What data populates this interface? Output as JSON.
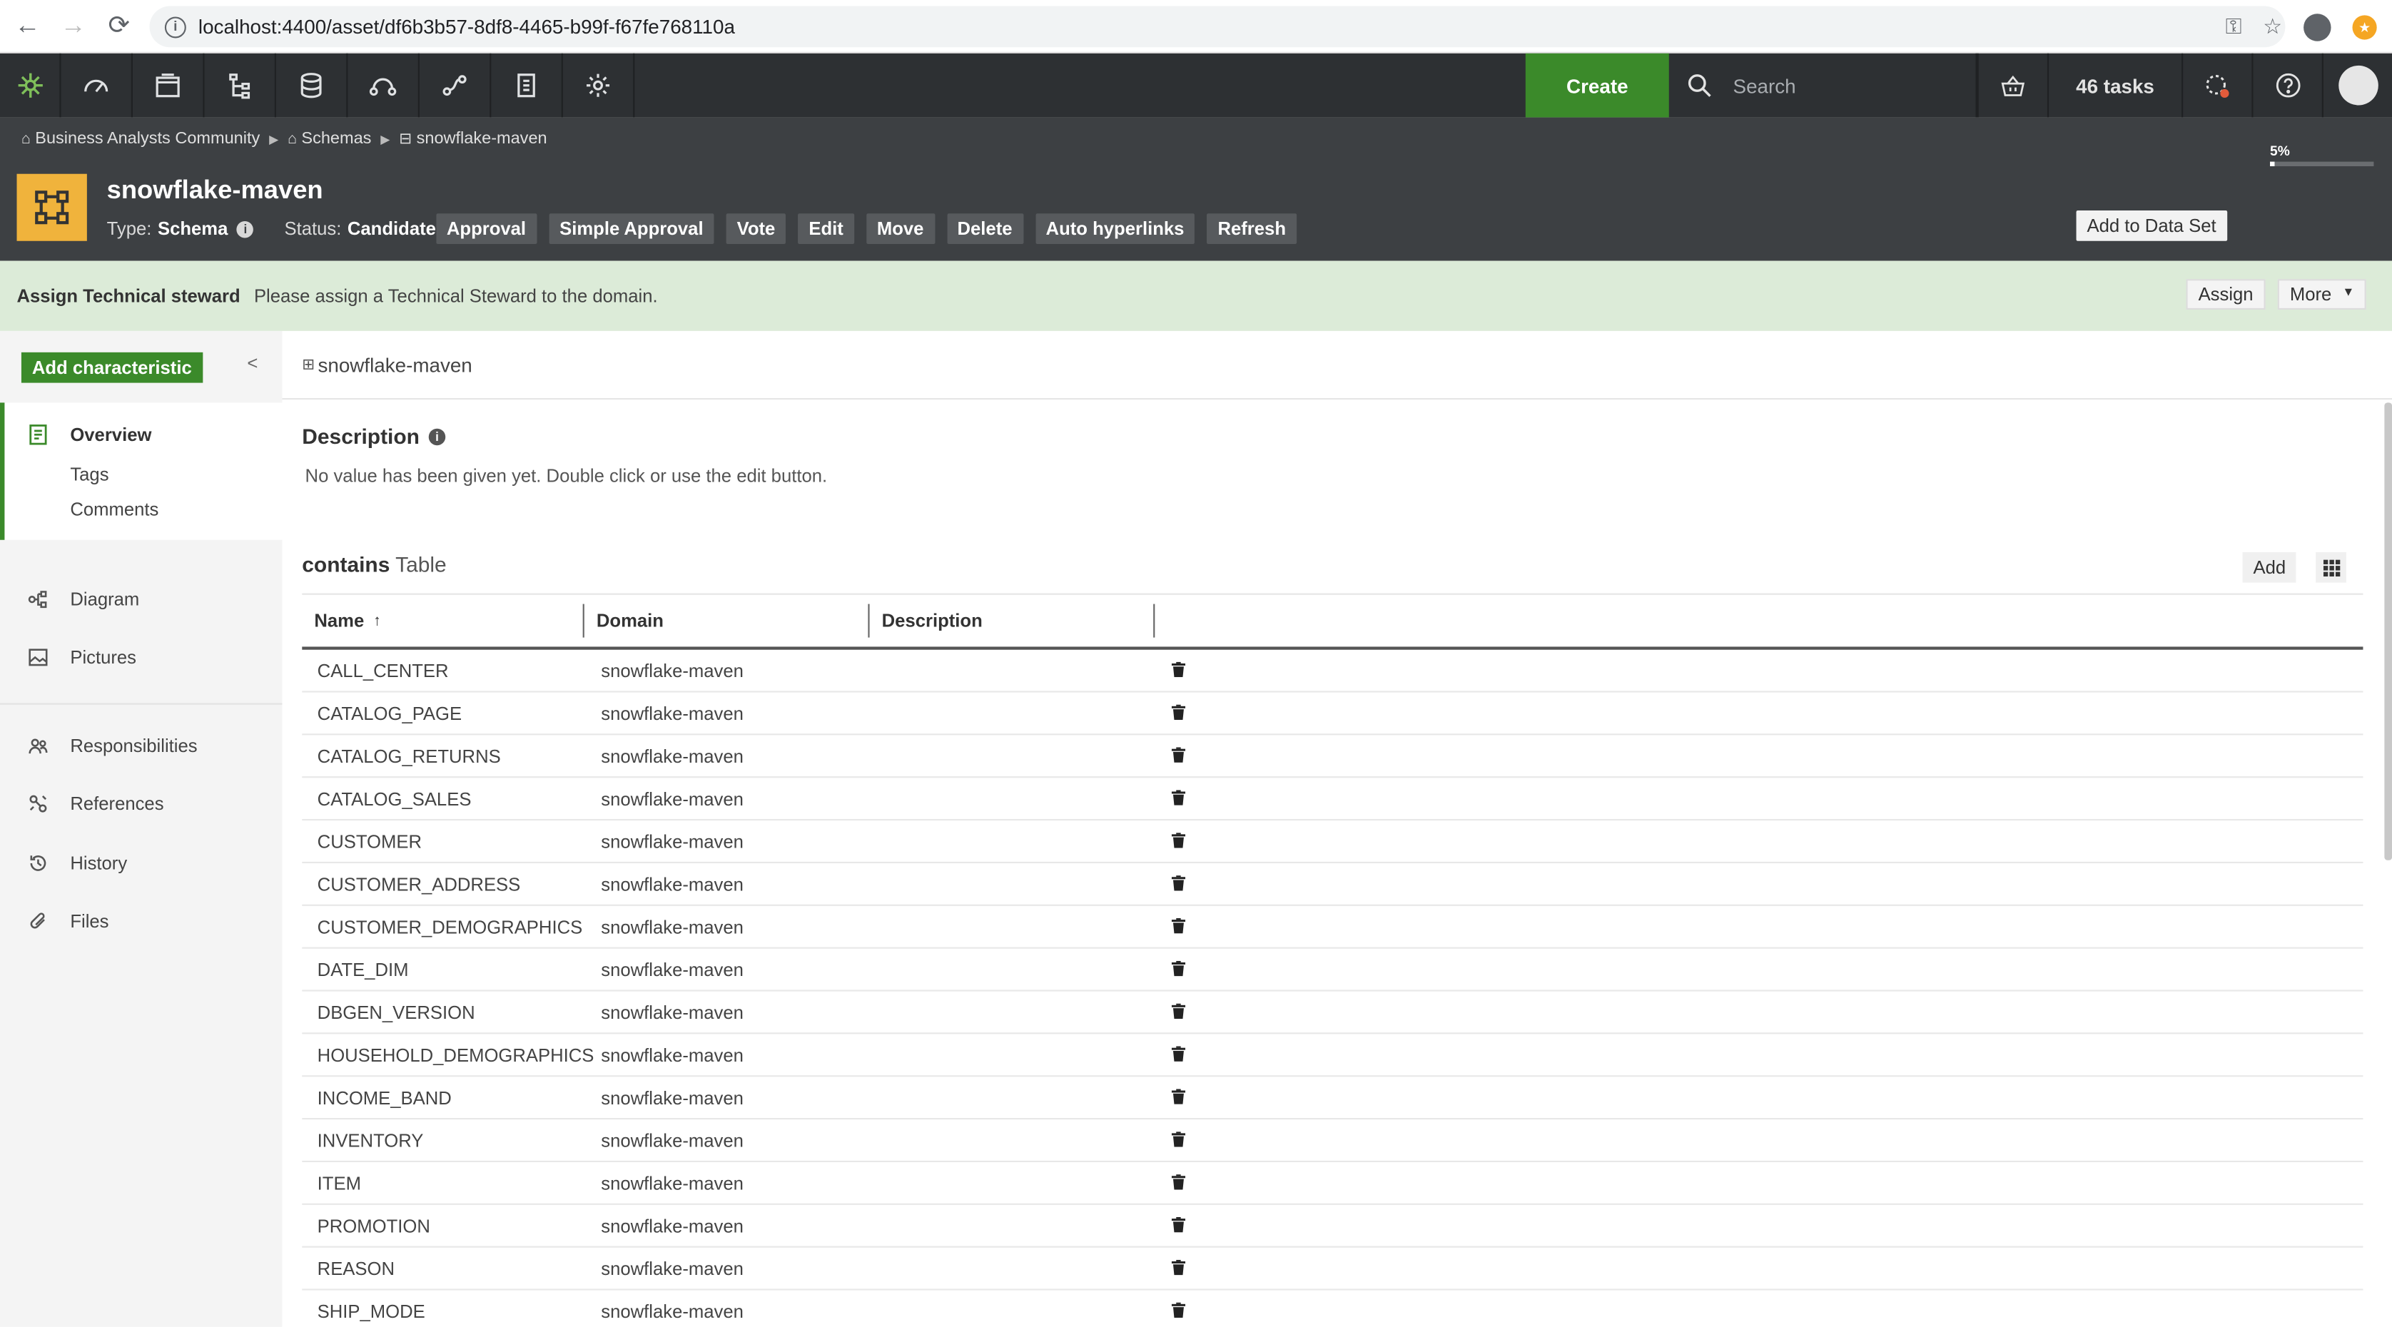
{
  "browser": {
    "url": "localhost:4400/asset/df6b3b57-8df8-4465-b99f-f67fe768110a"
  },
  "topbar": {
    "create_label": "Create",
    "search_placeholder": "Search",
    "tasks_label": "46 tasks",
    "nav_icons": [
      "dashboard-icon",
      "browse-icon",
      "hierarchy-icon",
      "database-icon",
      "workflow-icon",
      "lineage-icon",
      "reports-icon",
      "settings-icon"
    ]
  },
  "asset": {
    "breadcrumb": [
      "Business Analysts Community",
      "Schemas",
      "snowflake-maven"
    ],
    "title": "snowflake-maven",
    "type_label": "Type:",
    "type_value": "Schema",
    "status_label": "Status:",
    "status_value": "Candidate",
    "actions": [
      "Approval",
      "Simple Approval",
      "Vote",
      "Edit",
      "Move",
      "Delete",
      "Auto hyperlinks",
      "Refresh"
    ],
    "add_to_data_set": "Add to Data Set",
    "progress_label": "5%",
    "progress_value": 0.05
  },
  "notice": {
    "title": "Assign Technical steward",
    "message": "Please assign a Technical Steward to the domain.",
    "assign_label": "Assign",
    "more_label": "More"
  },
  "sidebar": {
    "add_characteristic": "Add characteristic",
    "overview": "Overview",
    "tags": "Tags",
    "comments": "Comments",
    "diagram": "Diagram",
    "pictures": "Pictures",
    "responsibilities": "Responsibilities",
    "references": "References",
    "history": "History",
    "files": "Files"
  },
  "main": {
    "crumb": "snowflake-maven",
    "description_title": "Description",
    "description_text": "No value has been given yet. Double click or use the edit button.",
    "relation_bold": "contains",
    "relation_target": "Table",
    "add_label": "Add",
    "columns": [
      "Name",
      "Domain",
      "Description"
    ],
    "sort_indicator": "↑",
    "rows": [
      {
        "name": "CALL_CENTER",
        "domain": "snowflake-maven"
      },
      {
        "name": "CATALOG_PAGE",
        "domain": "snowflake-maven"
      },
      {
        "name": "CATALOG_RETURNS",
        "domain": "snowflake-maven"
      },
      {
        "name": "CATALOG_SALES",
        "domain": "snowflake-maven"
      },
      {
        "name": "CUSTOMER",
        "domain": "snowflake-maven"
      },
      {
        "name": "CUSTOMER_ADDRESS",
        "domain": "snowflake-maven"
      },
      {
        "name": "CUSTOMER_DEMOGRAPHICS",
        "domain": "snowflake-maven"
      },
      {
        "name": "DATE_DIM",
        "domain": "snowflake-maven"
      },
      {
        "name": "DBGEN_VERSION",
        "domain": "snowflake-maven"
      },
      {
        "name": "HOUSEHOLD_DEMOGRAPHICS",
        "domain": "snowflake-maven"
      },
      {
        "name": "INCOME_BAND",
        "domain": "snowflake-maven"
      },
      {
        "name": "INVENTORY",
        "domain": "snowflake-maven"
      },
      {
        "name": "ITEM",
        "domain": "snowflake-maven"
      },
      {
        "name": "PROMOTION",
        "domain": "snowflake-maven"
      },
      {
        "name": "REASON",
        "domain": "snowflake-maven"
      },
      {
        "name": "SHIP_MODE",
        "domain": "snowflake-maven"
      }
    ]
  },
  "colors": {
    "accent_green": "#3b8a2a",
    "asset_icon": "#f0b33c",
    "topbar": "#2d3033",
    "header": "#3d4043",
    "notice": "#dcebd8"
  }
}
